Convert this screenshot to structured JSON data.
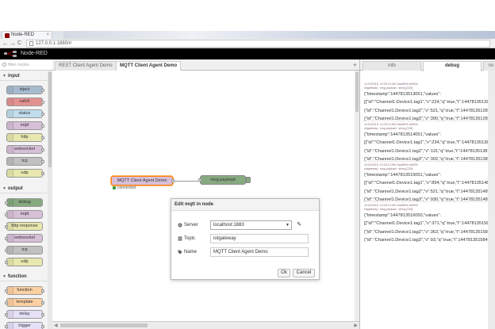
{
  "browser": {
    "tab_title": "Node-RED",
    "tab_close": "×",
    "back": "←",
    "forward": "→",
    "reload": "C",
    "url": "127.0.0.1:1880/#"
  },
  "app": {
    "title": "Node-RED"
  },
  "palette": {
    "search_placeholder": "filter nodes",
    "categories": [
      {
        "label": "input",
        "nodes": [
          "inject",
          "catch",
          "status",
          "mqtt",
          "http",
          "websocket",
          "tcp",
          "udp"
        ]
      },
      {
        "label": "output",
        "nodes": [
          "debug",
          "mqtt",
          "http response",
          "websocket",
          "tcp",
          "udp"
        ]
      },
      {
        "label": "function",
        "nodes": [
          "function",
          "template",
          "delay",
          "trigger"
        ]
      }
    ]
  },
  "workspace": {
    "tabs": [
      "REST Client Agent Demo",
      "MQTT Client Agent Demo"
    ],
    "add_tab": "+",
    "nodes": {
      "mqtt_in": "MQTT Client Agent Demo",
      "mqtt_status": "connected",
      "debug": "msg.payload"
    }
  },
  "dialog": {
    "title": "Edit mqtt in node",
    "server_label": "Server",
    "server_value": "localhost:1883",
    "topic_label": "Topic",
    "topic_value": "iotgateway",
    "name_label": "Name",
    "name_value": "MQTT Client Agent Demo",
    "ok_label": "Ok",
    "cancel_label": "Cancel"
  },
  "sidebar": {
    "tabs": [
      "info",
      "debug",
      "no"
    ],
    "messages": [
      {
        "meta": "11/24/2015, 10:25:10 AM   2aad5f1b.bb5f2e",
        "topic": "iotgateway : msg.payload : string [226]",
        "lines": [
          "{\"timestamp\":1447813513051,\"values\":",
          "[{\"id\":\"Channel1.Device1.tag1\",\"v\":224,\"q\":true,\"t\":1447813512802},",
          "{\"id\":\"Channel1.Device1.tag2\",\"v\":521,\"q\":true,\"t\":1447813512802},",
          "{\"id\":\"Channel1.Device1.tag3\",\"v\":390,\"q\":true,\"t\":1447813512802}]}"
        ]
      },
      {
        "meta": "11/24/2015, 10:25:12 AM   2aad5f1b.bb5f2e",
        "topic": "iotgateway : msg.payload : string [226]",
        "lines": [
          "{\"timestamp\":1447813514051,\"values\":",
          "[{\"id\":\"Channel1.Device1.tag1\",\"v\":234,\"q\":true,\"t\":1447813513812},",
          "{\"id\":\"Channel1.Device1.tag2\",\"v\":115,\"q\":true,\"t\":1447813513812},",
          "{\"id\":\"Channel1.Device1.tag3\",\"v\":302,\"q\":true,\"t\":1447813513812}]}"
        ]
      },
      {
        "meta": "11/24/2015, 10:25:13 AM   2aad5f1b.bb5f2e",
        "topic": "iotgateway : msg.payload : string [226]",
        "lines": [
          "{\"timestamp\":1447813515051,\"values\":",
          "[{\"id\":\"Channel1.Device1.tag1\",\"v\":894,\"q\":true,\"t\":1447813514832},",
          "{\"id\":\"Channel1.Device1.tag2\",\"v\":521,\"q\":true,\"t\":1447813514832},",
          "{\"id\":\"Channel1.Device1.tag3\",\"v\":930,\"q\":true,\"t\":1447813514832}]}"
        ]
      },
      {
        "meta": "11/24/2015, 10:25:14 AM   2aad5f1b.bb5f2e",
        "topic": "iotgateway : msg.payload : string [226]",
        "lines": [
          "{\"timestamp\":1447813516050,\"values\":",
          "[{\"id\":\"Channel1.Device1.tag1\",\"v\":371,\"q\":true,\"t\":1447813515842},",
          "{\"id\":\"Channel1.Device1.tag2\",\"v\":363,\"q\":true,\"t\":1447813515842},",
          "{\"id\":\"Channel1.Device1.tag3\",\"v\":93,\"q\":true,\"t\":1447813515842}]}"
        ]
      }
    ]
  },
  "colors": {
    "header_bg": "#000000",
    "selected_node_border": "#ff7f0e",
    "mqtt_node": "#d8bfd8",
    "debug_node": "#87a980",
    "input_nodes": [
      "#a6bbcf",
      "#e49191",
      "#c0deed",
      "#d8bfd8",
      "#e7e7ae",
      "#d8bfd8",
      "#c0c0c0",
      "#e7e7ae"
    ],
    "output_nodes": [
      "#87a980",
      "#d8bfd8",
      "#e7e7ae",
      "#d8bfd8",
      "#c0c0c0",
      "#e7e7ae"
    ],
    "function_nodes": [
      "#fdd0a2",
      "#fdd0a2",
      "#e6e0f8",
      "#e6e0f8"
    ]
  }
}
